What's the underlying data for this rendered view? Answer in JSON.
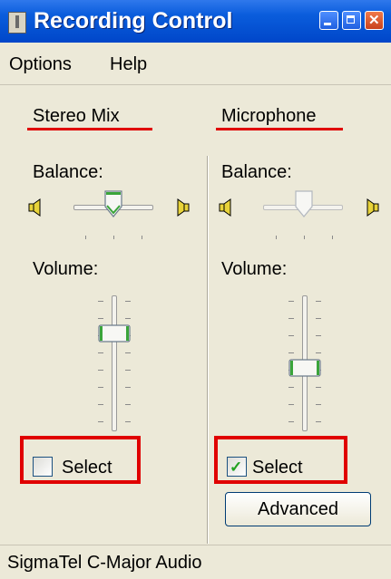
{
  "window": {
    "title": "Recording Control"
  },
  "menu": {
    "items": [
      "Options",
      "Help"
    ]
  },
  "channels": [
    {
      "name": "Stereo Mix",
      "balance_label": "Balance:",
      "volume_label": "Volume:",
      "select_label": "Select",
      "selected": false,
      "balance_level": 0.5,
      "volume_level": 0.75,
      "enabled": true
    },
    {
      "name": "Microphone",
      "balance_label": "Balance:",
      "volume_label": "Volume:",
      "select_label": "Select",
      "selected": true,
      "balance_level": 0.5,
      "volume_level": 0.45,
      "enabled": false
    }
  ],
  "advanced_button": {
    "label": "Advanced"
  },
  "status": {
    "text": "SigmaTel C-Major Audio"
  },
  "colors": {
    "highlight_red": "#e00000",
    "titlebar_blue": "#0a5ddc",
    "thumb_green": "#3aa43a"
  }
}
